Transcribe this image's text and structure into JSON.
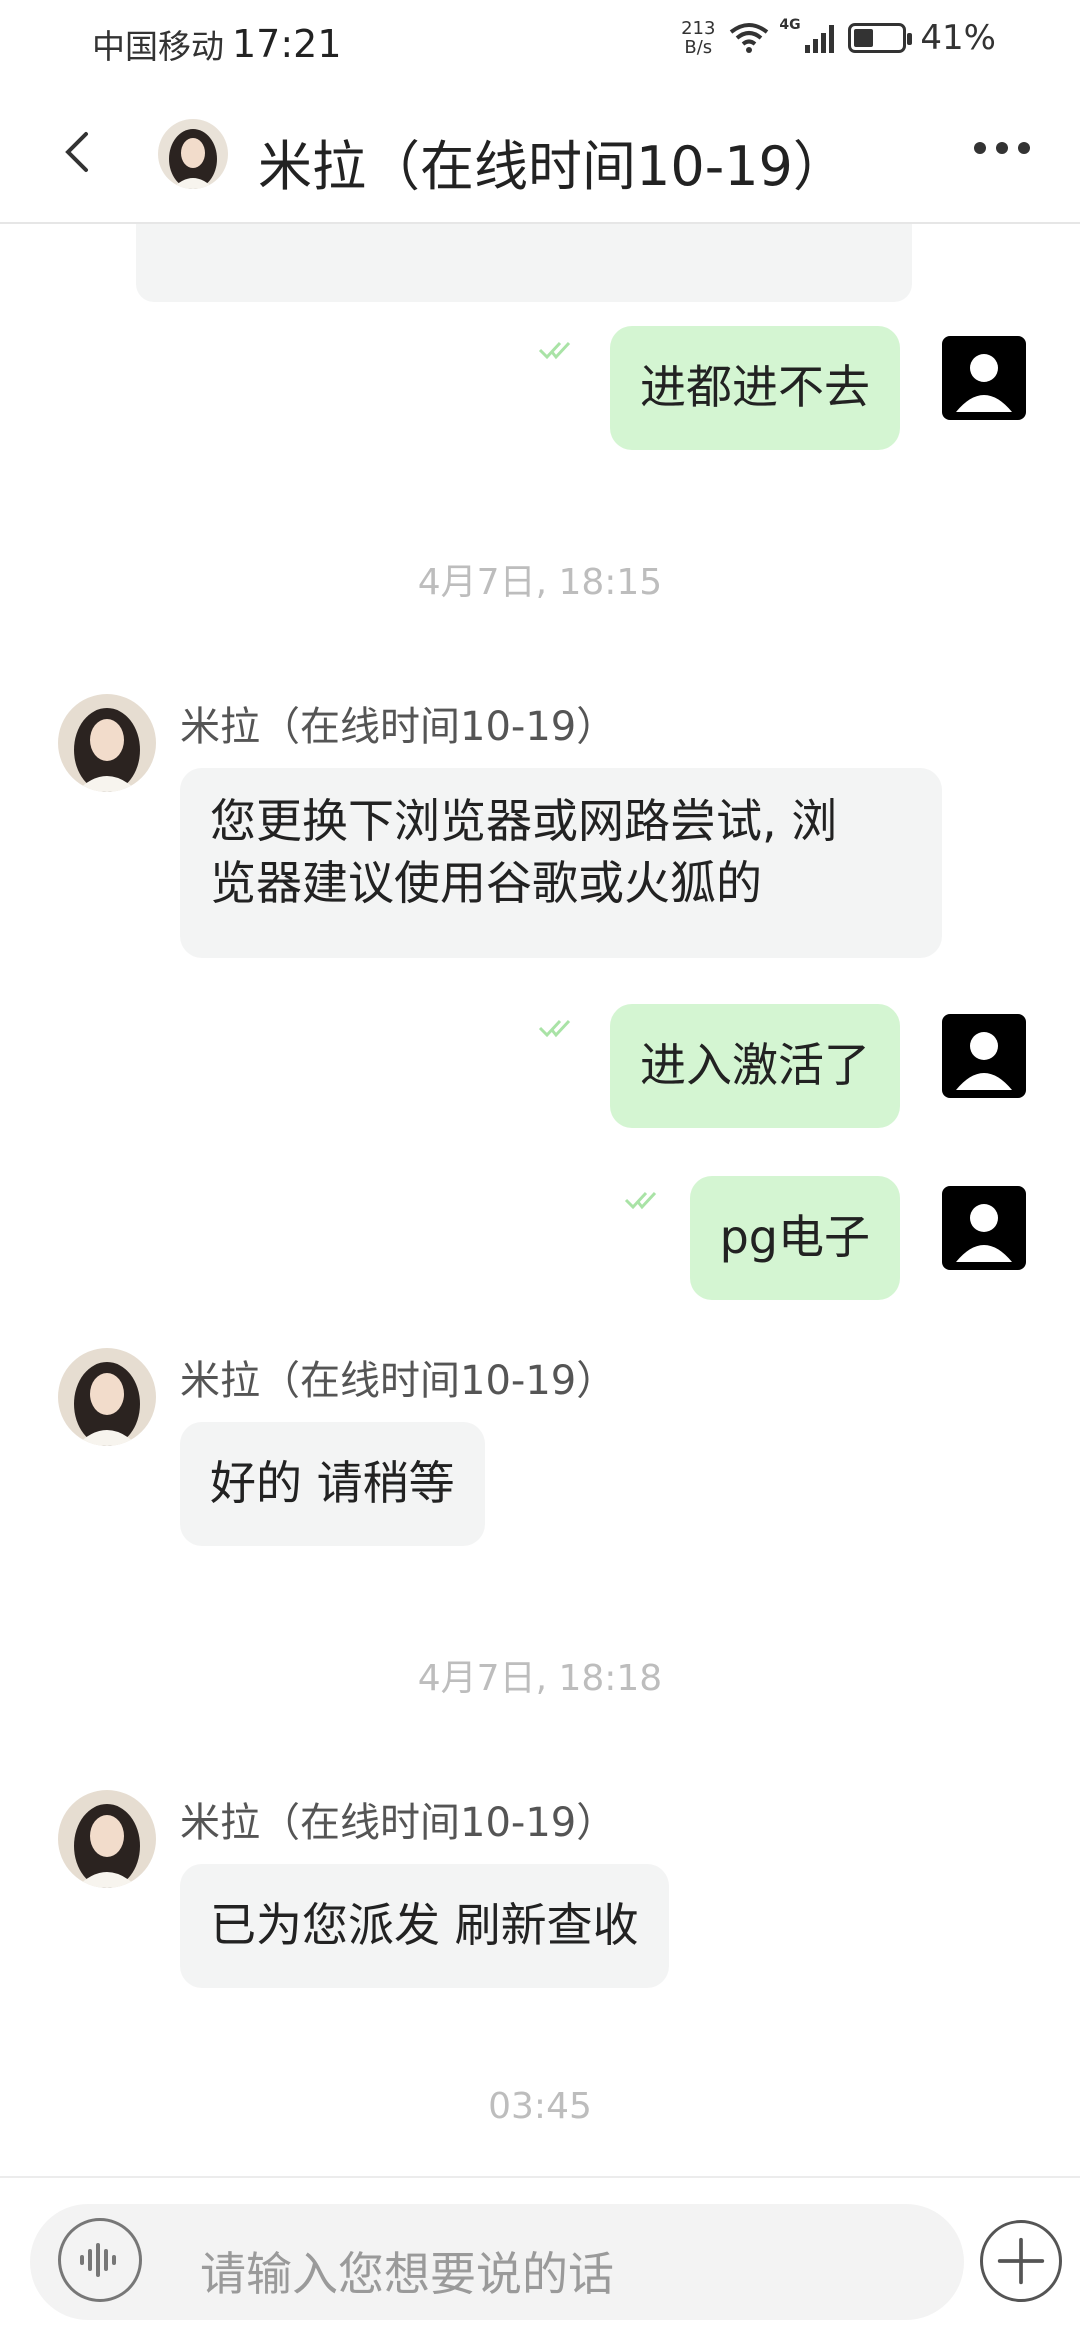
{
  "status_bar": {
    "carrier": "中国移动",
    "time": "17:21",
    "net_speed_value": "213",
    "net_speed_unit": "B/s",
    "network_type": "4G",
    "battery_percent": "41%",
    "battery_level": 0.41
  },
  "header": {
    "title": "米拉（在线时间10-19）"
  },
  "messages": [
    {
      "side": "me",
      "text": "进都进不去"
    },
    {
      "side": "stamp",
      "text": "4月7日, 18:15"
    },
    {
      "side": "them",
      "name": "米拉（在线时间10-19）",
      "line1": "您更换下浏览器或网路尝试, 浏",
      "line2": "览器建议使用谷歌或火狐的"
    },
    {
      "side": "me",
      "text": "进入激活了"
    },
    {
      "side": "me",
      "text": "pg电子"
    },
    {
      "side": "them",
      "name": "米拉（在线时间10-19）",
      "text": "好的 请稍等"
    },
    {
      "side": "stamp",
      "text": "4月7日, 18:18"
    },
    {
      "side": "them",
      "name": "米拉（在线时间10-19）",
      "text": "已为您派发 刷新查收"
    },
    {
      "side": "stamp",
      "text": "03:45"
    }
  ],
  "input": {
    "placeholder": "请输入您想要说的话"
  },
  "colors": {
    "my_bubble": "#d4f5d2",
    "their_bubble": "#f3f4f4",
    "read_tick": "#a9e3a6",
    "timestamp": "#bdbdbd"
  }
}
